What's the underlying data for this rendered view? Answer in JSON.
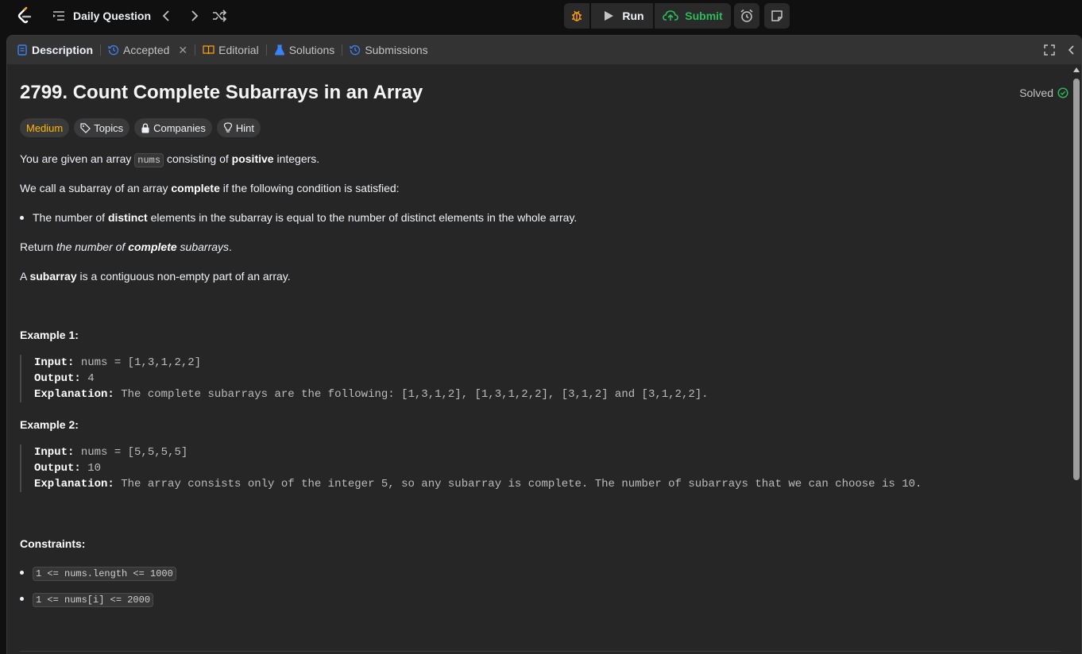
{
  "topbar": {
    "daily_label": "Daily Question",
    "run_label": "Run",
    "submit_label": "Submit"
  },
  "tabs": [
    {
      "label": "Description",
      "active": true
    },
    {
      "label": "Accepted"
    },
    {
      "label": "Editorial"
    },
    {
      "label": "Solutions"
    },
    {
      "label": "Submissions"
    }
  ],
  "problem": {
    "title": "2799. Count Complete Subarrays in an Array",
    "status": "Solved",
    "tags": {
      "difficulty": "Medium",
      "topics": "Topics",
      "companies": "Companies",
      "hint": "Hint"
    },
    "p1": {
      "a": "You are given an array ",
      "code": "nums",
      "b": " consisting of ",
      "bold": "positive",
      "c": " integers."
    },
    "p2": {
      "a": "We call a subarray of an array ",
      "bold": "complete",
      "b": " if the following condition is satisfied:"
    },
    "bullet": {
      "a": "The number of ",
      "bold": "distinct",
      "b": " elements in the subarray is equal to the number of distinct elements in the whole array."
    },
    "p3": {
      "a": "Return ",
      "i1": "the number of ",
      "bold": "complete",
      "i2": " subarrays",
      "b": "."
    },
    "p4": {
      "a": "A ",
      "bold": "subarray",
      "b": " is a contiguous non-empty part of an array."
    }
  },
  "examples": [
    {
      "heading": "Example 1:",
      "input_label": "Input:",
      "input": " nums = [1,3,1,2,2]",
      "output_label": "Output:",
      "output": " 4",
      "expl_label": "Explanation:",
      "expl": " The complete subarrays are the following: [1,3,1,2], [1,3,1,2,2], [3,1,2] and [3,1,2,2]."
    },
    {
      "heading": "Example 2:",
      "input_label": "Input:",
      "input": " nums = [5,5,5,5]",
      "output_label": "Output:",
      "output": " 10",
      "expl_label": "Explanation:",
      "expl": " The array consists only of the integer 5, so any subarray is complete. The number of subarrays that we can choose is 10."
    }
  ],
  "constraints": {
    "heading": "Constraints:",
    "items": [
      "1 <= nums.length <= 1000",
      "1 <= nums[i] <= 2000"
    ]
  },
  "colors": {
    "accent_green": "#2cbb5d",
    "medium": "#ffb800",
    "logo_orange": "#ffa116"
  },
  "icons": [
    "leetcode-logo-icon",
    "list-icon",
    "chevron-left-icon",
    "chevron-right-icon",
    "shuffle-icon",
    "debug-icon",
    "play-icon",
    "cloud-upload-icon",
    "alarm-clock-icon",
    "note-icon",
    "description-icon",
    "history-icon",
    "book-icon",
    "flask-icon",
    "fullscreen-icon",
    "collapse-icon",
    "tag-icon",
    "lock-icon",
    "lightbulb-icon",
    "check-circle-icon"
  ]
}
